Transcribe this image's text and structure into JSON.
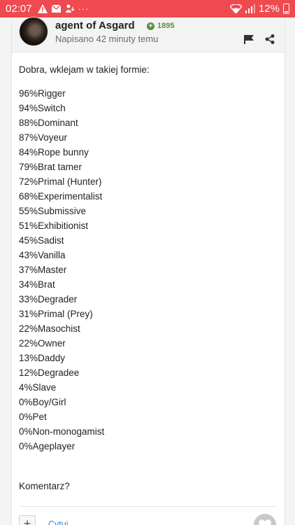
{
  "statusbar": {
    "time": "02:07",
    "battery": "12%"
  },
  "post": {
    "author": "agent of Asgard",
    "reputation": "1895",
    "posted": "Napisano 42 minuty temu",
    "intro": "Dobra, wklejam w takiej formie:",
    "results": [
      "96%Rigger",
      "94%Switch",
      "88%Dominant",
      "87%Voyeur",
      "84%Rope bunny",
      "79%Brat tamer",
      "72%Primal (Hunter)",
      "68%Experimentalist",
      "55%Submissive",
      "51%Exhibitionist",
      "45%Sadist",
      "43%Vanilla",
      "37%Master",
      "34%Brat",
      "33%Degrader",
      "31%Primal (Prey)",
      "22%Masochist",
      "22%Owner",
      "13%Daddy",
      "12%Degradee",
      "4%Slave",
      "0%Boy/Girl",
      "0%Pet",
      "0%Non-monogamist",
      "0%Ageplayer"
    ],
    "outro": "Komentarz?"
  },
  "footer": {
    "add": "+",
    "quote": "Cytuj"
  }
}
